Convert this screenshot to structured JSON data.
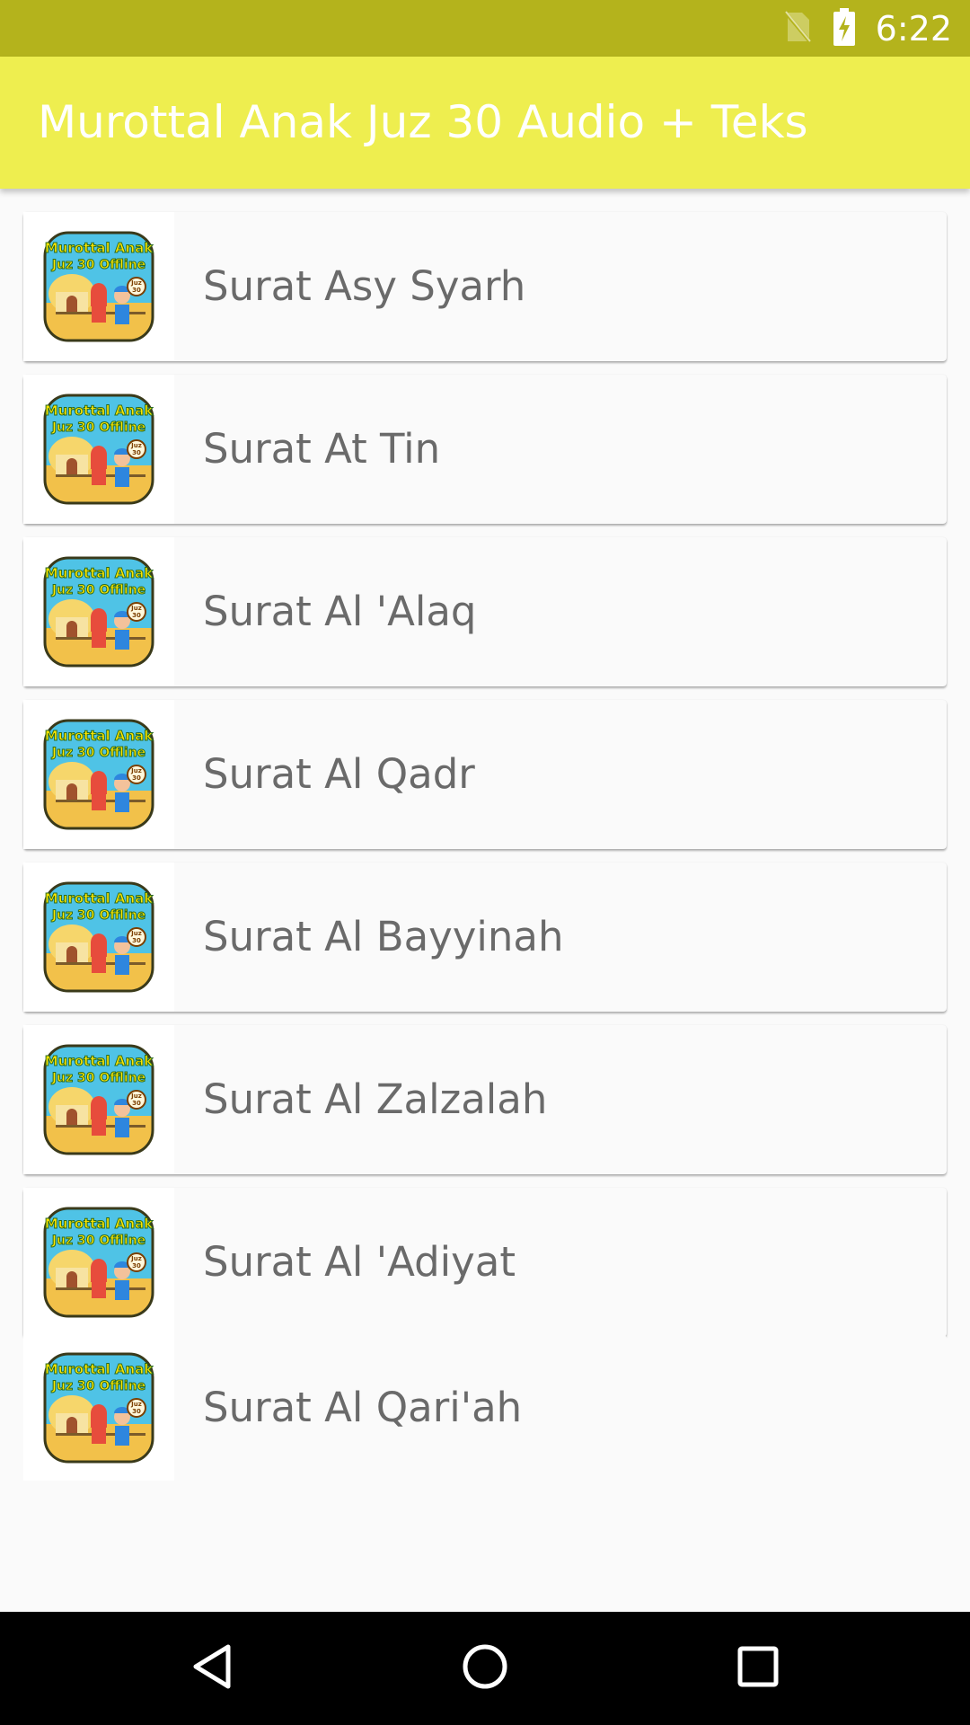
{
  "status_bar": {
    "time": "6:22",
    "icons": [
      "no-sim-icon",
      "battery-charging-icon"
    ],
    "color": "#b4b31c"
  },
  "app_bar": {
    "title": "Murottal Anak Juz 30 Audio + Teks",
    "color": "#eeee4f"
  },
  "list": {
    "items": [
      {
        "label": "Surat Asy Syarh",
        "icon": "app-logo-thumbnail"
      },
      {
        "label": "Surat At Tin",
        "icon": "app-logo-thumbnail"
      },
      {
        "label": "Surat Al 'Alaq",
        "icon": "app-logo-thumbnail"
      },
      {
        "label": "Surat Al Qadr",
        "icon": "app-logo-thumbnail"
      },
      {
        "label": "Surat Al Bayyinah",
        "icon": "app-logo-thumbnail"
      },
      {
        "label": "Surat Al Zalzalah",
        "icon": "app-logo-thumbnail"
      },
      {
        "label": "Surat Al 'Adiyat",
        "icon": "app-logo-thumbnail"
      },
      {
        "label": "Surat Al Qari'ah",
        "icon": "app-logo-thumbnail"
      }
    ]
  },
  "thumbnail": {
    "line1": "Murottal Anak",
    "line2": "Juz 30 Offline",
    "badge_top": "Juz",
    "badge_bottom": "30"
  },
  "nav_bar": {
    "buttons": [
      "back-icon",
      "home-icon",
      "recents-icon"
    ]
  }
}
